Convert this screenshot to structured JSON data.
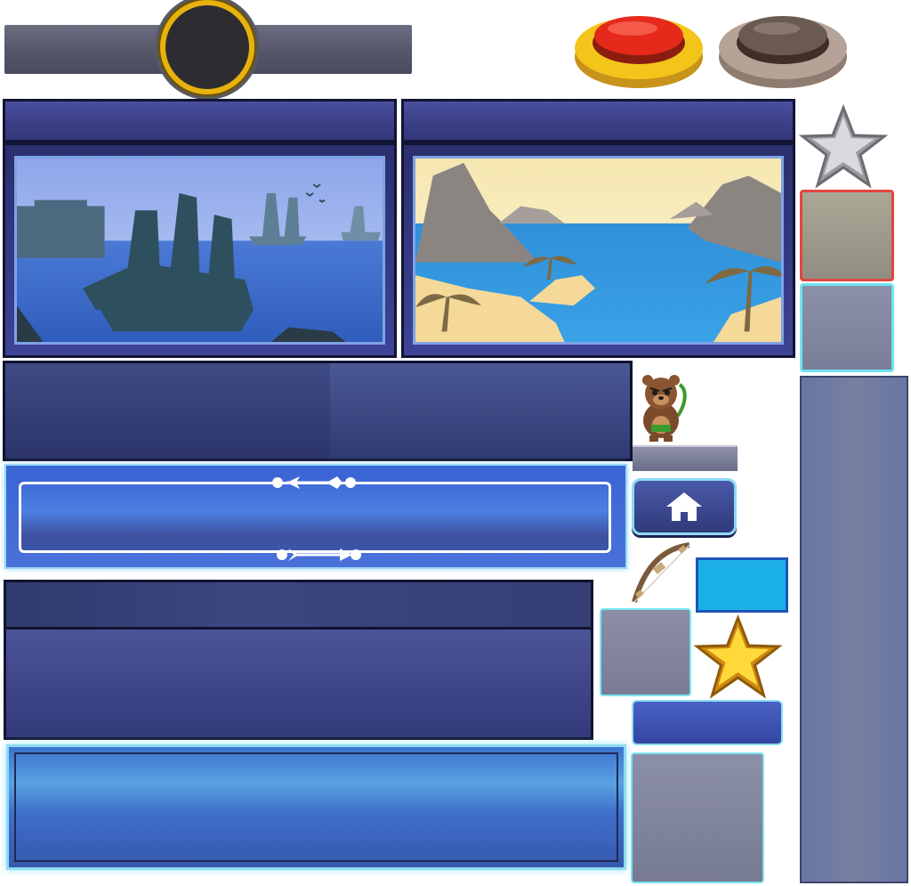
{
  "slider": {
    "track": "slider-track",
    "knob": "slider-knob"
  },
  "buttons": {
    "red": "red-push-button",
    "brown": "brown-push-button",
    "home": "home-icon"
  },
  "scenes": [
    {
      "name": "harbor-ships-scene",
      "sky": "#9cb4ee",
      "sea": "#3d6fd1"
    },
    {
      "name": "tropical-island-scene",
      "sky": "#f4e6b0",
      "sea": "#2c8ed6"
    }
  ],
  "sprites": {
    "character": "bear-archer",
    "weapon": "bow-icon",
    "stars": [
      "silver-star-icon",
      "gold-star-icon"
    ]
  },
  "colors": {
    "panel": "#3a3f85",
    "frame_border": "#121433",
    "glow": "#8edaf4",
    "red_button": "#e52a1c",
    "gold": "#e8b20c"
  }
}
